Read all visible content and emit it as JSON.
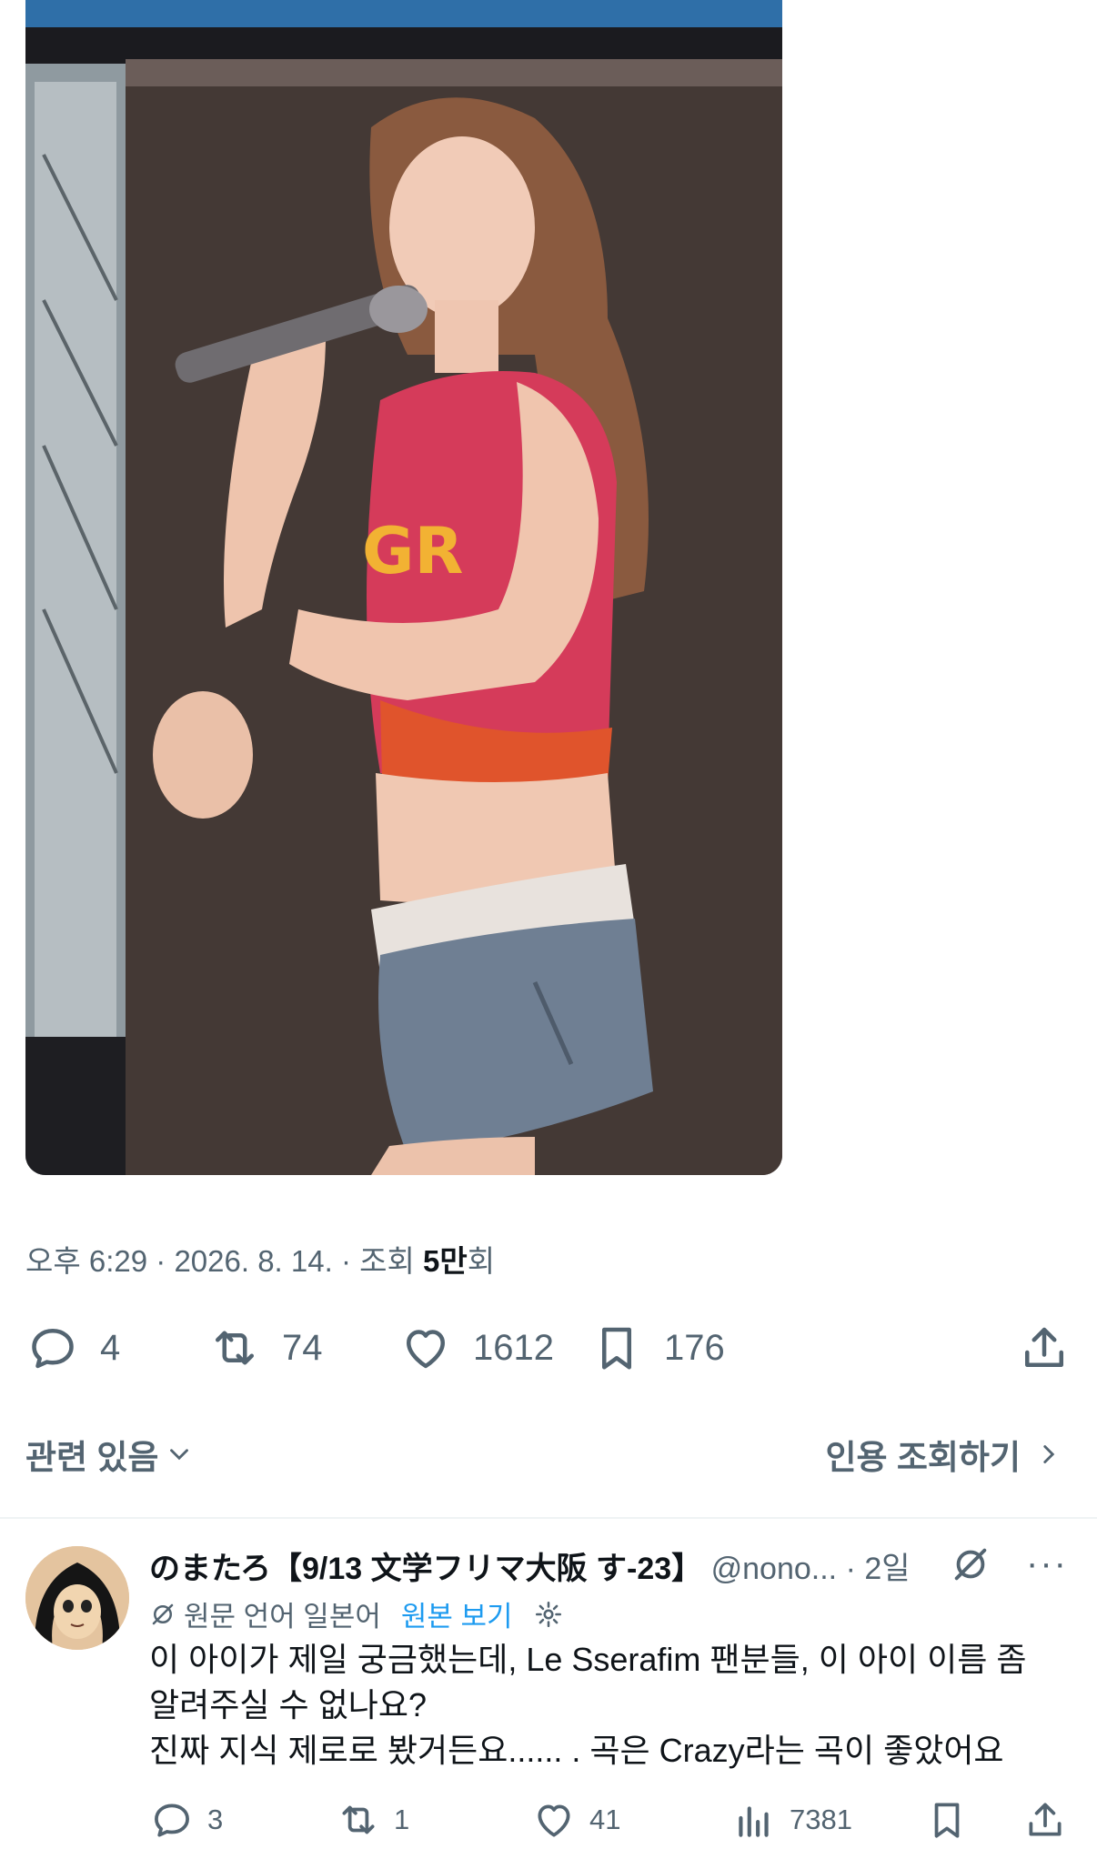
{
  "tweet": {
    "time": "오후 6:29",
    "date": "2026. 8. 14.",
    "views_prefix": "조회",
    "views_value": "5만",
    "views_suffix": "회",
    "stats": {
      "replies": "4",
      "reposts": "74",
      "likes": "1612",
      "bookmarks": "176"
    },
    "related_label": "관련 있음",
    "quote_views_label": "인용 조회하기"
  },
  "reply": {
    "name": "のまたろ【9/13 文学フリマ大阪 す-23】",
    "handle": "@nono...",
    "age": "2일",
    "translated_from": "원문 언어 일본어",
    "show_original": "원본 보기",
    "text_lines": [
      "이 아이가 제일 궁금했는데, Le Sserafim 팬분들, 이 아이 이름 좀",
      "알려주실 수 없나요?",
      "진짜 지식 제로로 봤거든요...... . 곡은 Crazy라는 곡이 좋았어요"
    ],
    "stats": {
      "replies": "3",
      "reposts": "1",
      "likes": "41",
      "views": "7381"
    }
  },
  "colors": {
    "secondary_text": "#536471",
    "link": "#1d9bf0",
    "primary_text": "#0f1419"
  }
}
